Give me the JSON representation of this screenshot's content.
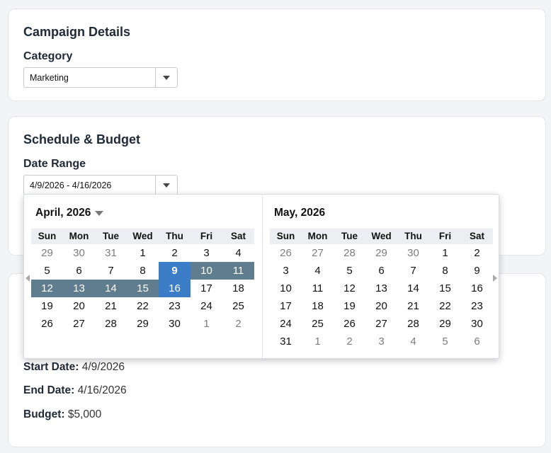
{
  "campaign": {
    "title": "Campaign Details",
    "category_label": "Category",
    "category_value": "Marketing"
  },
  "schedule": {
    "title": "Schedule & Budget",
    "date_range_label": "Date Range",
    "date_range_value": "4/9/2026 - 4/16/2026"
  },
  "summary": {
    "start_label": "Start Date:",
    "start_value": "4/9/2026",
    "end_label": "End Date:",
    "end_value": "4/16/2026",
    "budget_label": "Budget:",
    "budget_value": "$5,000"
  },
  "calendar": {
    "day_names": [
      "Sun",
      "Mon",
      "Tue",
      "Wed",
      "Thu",
      "Fri",
      "Sat"
    ],
    "colors": {
      "range": "#5f7d8f",
      "endpoint": "#3b7dc6"
    },
    "months": [
      {
        "title": "April, 2026",
        "has_dropdown": true,
        "weeks": [
          [
            {
              "d": "29",
              "o": true
            },
            {
              "d": "30",
              "o": true
            },
            {
              "d": "31",
              "o": true
            },
            {
              "d": "1"
            },
            {
              "d": "2"
            },
            {
              "d": "3"
            },
            {
              "d": "4"
            }
          ],
          [
            {
              "d": "5"
            },
            {
              "d": "6"
            },
            {
              "d": "7"
            },
            {
              "d": "8"
            },
            {
              "d": "9",
              "s": "start"
            },
            {
              "d": "10",
              "s": "range"
            },
            {
              "d": "11",
              "s": "range"
            }
          ],
          [
            {
              "d": "12",
              "s": "range"
            },
            {
              "d": "13",
              "s": "range"
            },
            {
              "d": "14",
              "s": "range"
            },
            {
              "d": "15",
              "s": "range"
            },
            {
              "d": "16",
              "s": "end"
            },
            {
              "d": "17"
            },
            {
              "d": "18"
            }
          ],
          [
            {
              "d": "19"
            },
            {
              "d": "20"
            },
            {
              "d": "21"
            },
            {
              "d": "22"
            },
            {
              "d": "23"
            },
            {
              "d": "24"
            },
            {
              "d": "25"
            }
          ],
          [
            {
              "d": "26"
            },
            {
              "d": "27"
            },
            {
              "d": "28"
            },
            {
              "d": "29"
            },
            {
              "d": "30"
            },
            {
              "d": "1",
              "o": true
            },
            {
              "d": "2",
              "o": true
            }
          ]
        ]
      },
      {
        "title": "May, 2026",
        "has_dropdown": false,
        "weeks": [
          [
            {
              "d": "26",
              "o": true
            },
            {
              "d": "27",
              "o": true
            },
            {
              "d": "28",
              "o": true
            },
            {
              "d": "29",
              "o": true
            },
            {
              "d": "30",
              "o": true
            },
            {
              "d": "1"
            },
            {
              "d": "2"
            }
          ],
          [
            {
              "d": "3"
            },
            {
              "d": "4"
            },
            {
              "d": "5"
            },
            {
              "d": "6"
            },
            {
              "d": "7"
            },
            {
              "d": "8"
            },
            {
              "d": "9"
            }
          ],
          [
            {
              "d": "10"
            },
            {
              "d": "11"
            },
            {
              "d": "12"
            },
            {
              "d": "13"
            },
            {
              "d": "14"
            },
            {
              "d": "15"
            },
            {
              "d": "16"
            }
          ],
          [
            {
              "d": "17"
            },
            {
              "d": "18"
            },
            {
              "d": "19"
            },
            {
              "d": "20"
            },
            {
              "d": "21"
            },
            {
              "d": "22"
            },
            {
              "d": "23"
            }
          ],
          [
            {
              "d": "24"
            },
            {
              "d": "25"
            },
            {
              "d": "26"
            },
            {
              "d": "27"
            },
            {
              "d": "28"
            },
            {
              "d": "29"
            },
            {
              "d": "30"
            }
          ],
          [
            {
              "d": "31"
            },
            {
              "d": "1",
              "o": true
            },
            {
              "d": "2",
              "o": true
            },
            {
              "d": "3",
              "o": true
            },
            {
              "d": "4",
              "o": true
            },
            {
              "d": "5",
              "o": true
            },
            {
              "d": "6",
              "o": true
            }
          ]
        ]
      }
    ]
  }
}
